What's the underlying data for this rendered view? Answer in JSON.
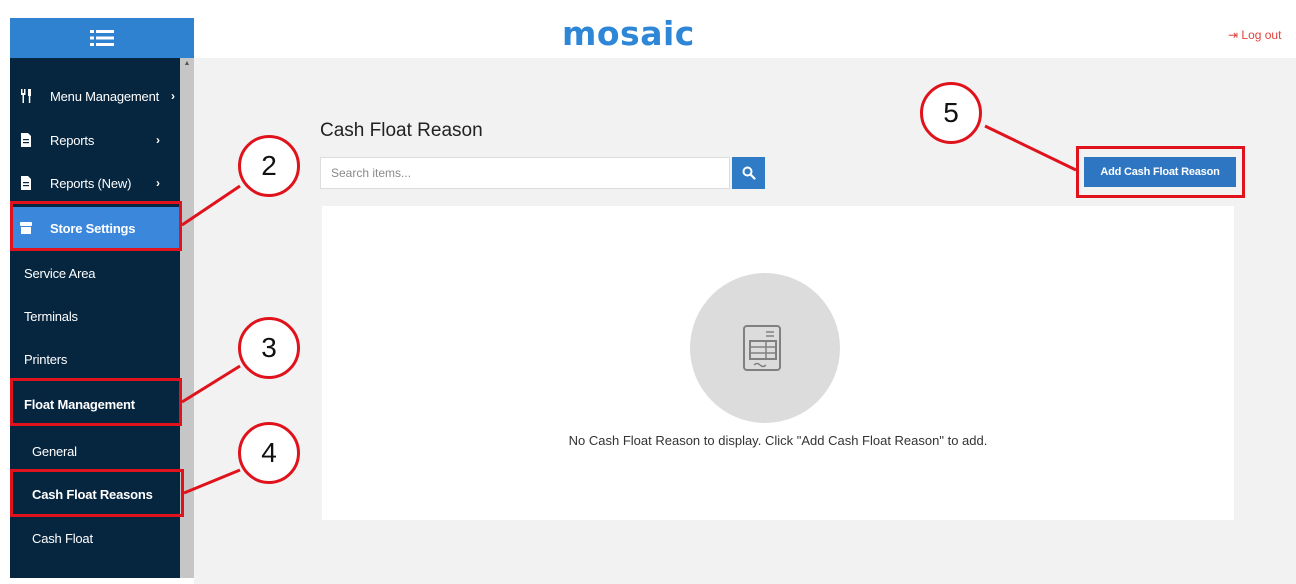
{
  "header": {
    "logo_text": "mosaic",
    "logout_label": "Log out"
  },
  "sidebar": {
    "toggle_icon": "list-icon",
    "items": [
      {
        "label": "Menu Management",
        "icon": "cutlery-icon",
        "has_submenu": true
      },
      {
        "label": "Reports",
        "icon": "document-icon",
        "has_submenu": true
      },
      {
        "label": "Reports (New)",
        "icon": "document-icon",
        "has_submenu": true
      },
      {
        "label": "Store Settings",
        "icon": "store-icon",
        "active": true
      }
    ],
    "store_settings_items": [
      "Service Area",
      "Terminals",
      "Printers",
      "Float Management"
    ],
    "float_management_items": [
      "General",
      "Cash Float Reasons",
      "Cash Float"
    ]
  },
  "main": {
    "title": "Cash Float Reason",
    "search": {
      "placeholder": "Search items...",
      "value": ""
    },
    "add_button_label": "Add Cash Float Reason",
    "empty_message": "No Cash Float Reason to display. Click \"Add Cash Float Reason\" to add.",
    "empty_icon": "receipt-icon"
  },
  "annotations": {
    "callouts": [
      "2",
      "3",
      "4",
      "5"
    ],
    "highlight_color": "#e0131c"
  },
  "colors": {
    "sidebar_bg": "#06253f",
    "accent": "#2f82cf",
    "active_item": "#3b87db",
    "logout": "#e0433c"
  }
}
